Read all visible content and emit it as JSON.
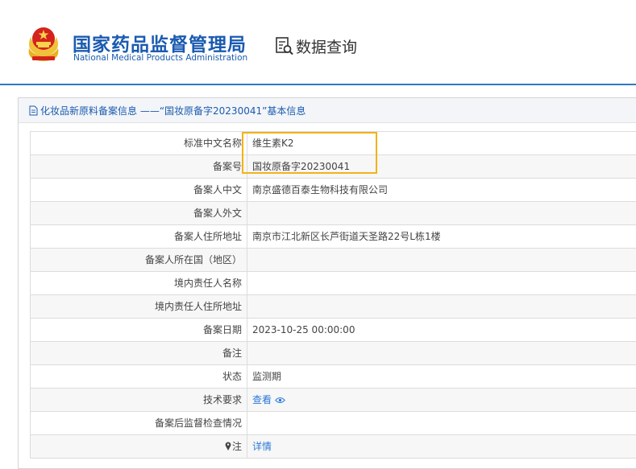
{
  "header": {
    "org_name_cn": "国家药品监督管理局",
    "org_name_en": "National Medical Products Administration",
    "query_title": "数据查询"
  },
  "panel": {
    "title": "化妆品新原料备案信息 ——“国妆原备字20230041”基本信息"
  },
  "rows": [
    {
      "label": "标准中文名称",
      "value": "维生素K2"
    },
    {
      "label": "备案号",
      "value": "国妆原备字20230041"
    },
    {
      "label": "备案人中文",
      "value": "南京盛德百泰生物科技有限公司"
    },
    {
      "label": "备案人外文",
      "value": ""
    },
    {
      "label": "备案人住所地址",
      "value": "南京市江北新区长芦街道天圣路22号L栋1楼"
    },
    {
      "label": "备案人所在国（地区）",
      "value": ""
    },
    {
      "label": "境内责任人名称",
      "value": ""
    },
    {
      "label": "境内责任人住所地址",
      "value": ""
    },
    {
      "label": "备案日期",
      "value": "2023-10-25 00:00:00"
    },
    {
      "label": "备注",
      "value": ""
    },
    {
      "label": "状态",
      "value": "监测期"
    },
    {
      "label": "技术要求",
      "value": "查看"
    },
    {
      "label": "备案后监督检查情况",
      "value": ""
    },
    {
      "label": "注",
      "value": "详情"
    }
  ],
  "icons": {
    "emblem": "national-emblem",
    "query": "document-search-icon",
    "panel": "document-icon",
    "view": "eye-icon",
    "note": "pin-icon"
  },
  "colors": {
    "brand_blue": "#1a5bb0",
    "link_blue": "#2b7ad6",
    "highlight": "#f2b316"
  }
}
